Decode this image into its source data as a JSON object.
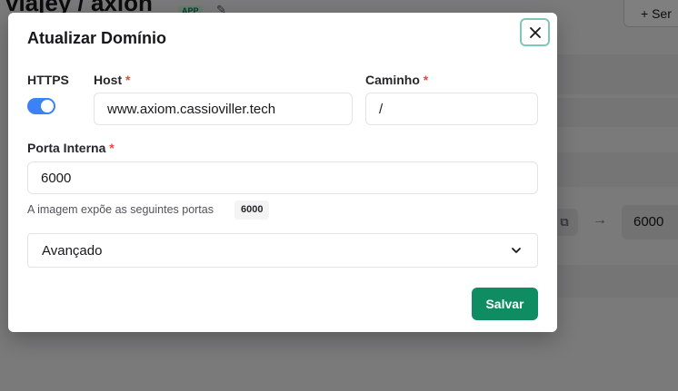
{
  "background": {
    "title": "viajey / axion",
    "badge": "APP",
    "edit_icon": "pencil-icon",
    "add_button_label": "+ Ser",
    "copy_icon": "clipboard-icon",
    "arrow_icon": "arrow-right-icon",
    "port_value": "6000"
  },
  "modal": {
    "title": "Atualizar Domínio",
    "close_icon": "close-icon",
    "https_label": "HTTPS",
    "https_enabled": true,
    "host": {
      "label": "Host",
      "required_mark": "*",
      "value": "www.axiom.cassioviller.tech"
    },
    "path": {
      "label": "Caminho",
      "required_mark": "*",
      "value": "/"
    },
    "internal_port": {
      "label": "Porta Interna",
      "required_mark": "*",
      "value": "6000"
    },
    "exposed_ports_hint": "A imagem expõe as seguintes portas",
    "exposed_ports": [
      "6000"
    ],
    "advanced_label": "Avançado",
    "save_label": "Salvar"
  },
  "colors": {
    "primary": "#0f8c61",
    "toggle_on": "#3b82f6",
    "required": "#ef4444"
  }
}
